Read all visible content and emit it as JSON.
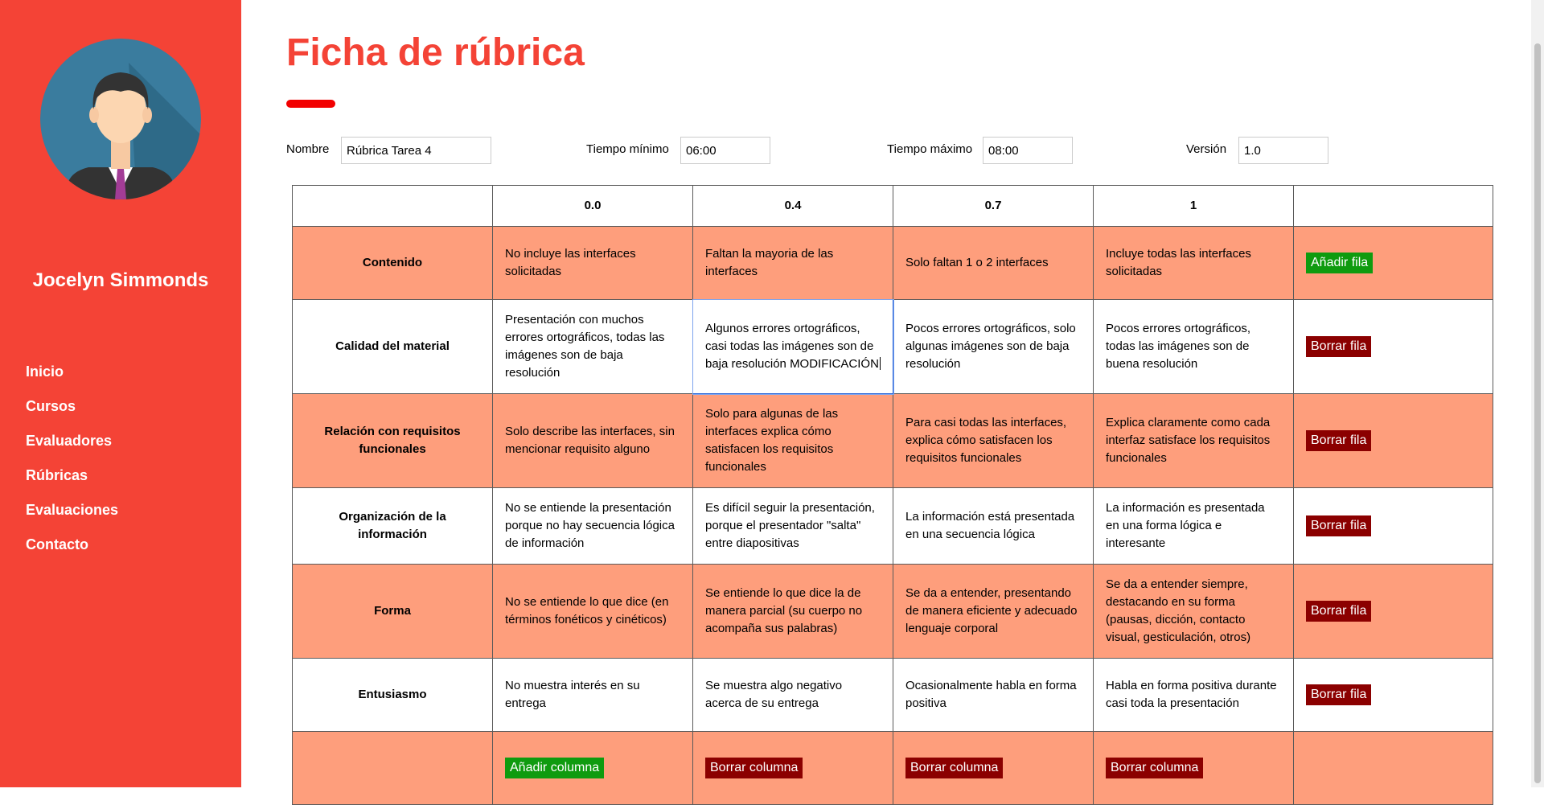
{
  "user": {
    "name": "Jocelyn Simmonds",
    "avatar_icon": "user-avatar-icon"
  },
  "nav": {
    "items": [
      {
        "label": "Inicio"
      },
      {
        "label": "Cursos"
      },
      {
        "label": "Evaluadores"
      },
      {
        "label": "Rúbricas"
      },
      {
        "label": "Evaluaciones"
      },
      {
        "label": "Contacto"
      }
    ]
  },
  "page": {
    "title": "Ficha de rúbrica"
  },
  "form": {
    "nombre_label": "Nombre",
    "nombre_value": "Rúbrica Tarea 4",
    "tmin_label": "Tiempo mínimo",
    "tmin_value": "06:00",
    "tmax_label": "Tiempo máximo",
    "tmax_value": "08:00",
    "version_label": "Versión",
    "version_value": "1.0"
  },
  "table": {
    "levels": [
      "0.0",
      "0.4",
      "0.7",
      "1"
    ],
    "rows": [
      {
        "criterion": "Contenido",
        "cells": [
          "No incluye las interfaces solicitadas",
          "Faltan la mayoria de las interfaces",
          "Solo faltan 1 o 2 interfaces",
          "Incluye todas las interfaces solicitadas"
        ],
        "action": "Añadir fila"
      },
      {
        "criterion": "Calidad del material",
        "cells": [
          "Presentación con muchos errores ortográficos, todas las imágenes son de baja resolución",
          "Algunos errores ortográficos, casi todas las imágenes son de baja resolución MODIFICACIÓN",
          "Pocos errores ortográficos, solo algunas imágenes son de baja resolución",
          "Pocos errores ortográficos, todas las imágenes son de buena resolución"
        ],
        "action": "Borrar fila"
      },
      {
        "criterion": "Relación con requisitos funcionales",
        "cells": [
          "Solo describe las interfaces, sin mencionar requisito alguno",
          "Solo para algunas de las interfaces explica cómo satisfacen los requisitos funcionales",
          "Para casi todas las interfaces, explica cómo satisfacen los requisitos funcionales",
          "Explica claramente como cada interfaz satisface los requisitos funcionales"
        ],
        "action": "Borrar fila"
      },
      {
        "criterion": "Organización de la información",
        "cells": [
          "No se entiende la presentación porque no hay secuencia lógica de información",
          "Es difícil seguir la presentación, porque el presentador \"salta\" entre diapositivas",
          "La información está presentada en una secuencia lógica",
          "La información es presentada en una forma lógica e interesante"
        ],
        "action": "Borrar fila"
      },
      {
        "criterion": "Forma",
        "cells": [
          "No se entiende lo que dice (en términos fonéticos y cinéticos)",
          "Se entiende lo que dice la de manera parcial (su cuerpo no acompaña sus palabras)",
          "Se da a entender, presentando de manera eficiente y adecuado lenguaje corporal",
          "Se da a entender siempre, destacando en su forma (pausas, dicción, contacto visual, gesticulación, otros)"
        ],
        "action": "Borrar fila"
      },
      {
        "criterion": "Entusiasmo",
        "cells": [
          "No muestra interés en su entrega",
          "Se muestra algo negativo acerca de su entrega",
          "Ocasionalmente habla en forma positiva",
          "Habla en forma positiva durante casi toda la presentación"
        ],
        "action": "Borrar fila"
      }
    ],
    "column_actions": [
      "Añadir columna",
      "Borrar columna",
      "Borrar columna",
      "Borrar columna"
    ]
  },
  "colors": {
    "sidebar": "#f44336",
    "title": "#f44336",
    "row_alt": "#fe9e7c",
    "add": "#0f9b0f",
    "delete": "#8b0000"
  }
}
